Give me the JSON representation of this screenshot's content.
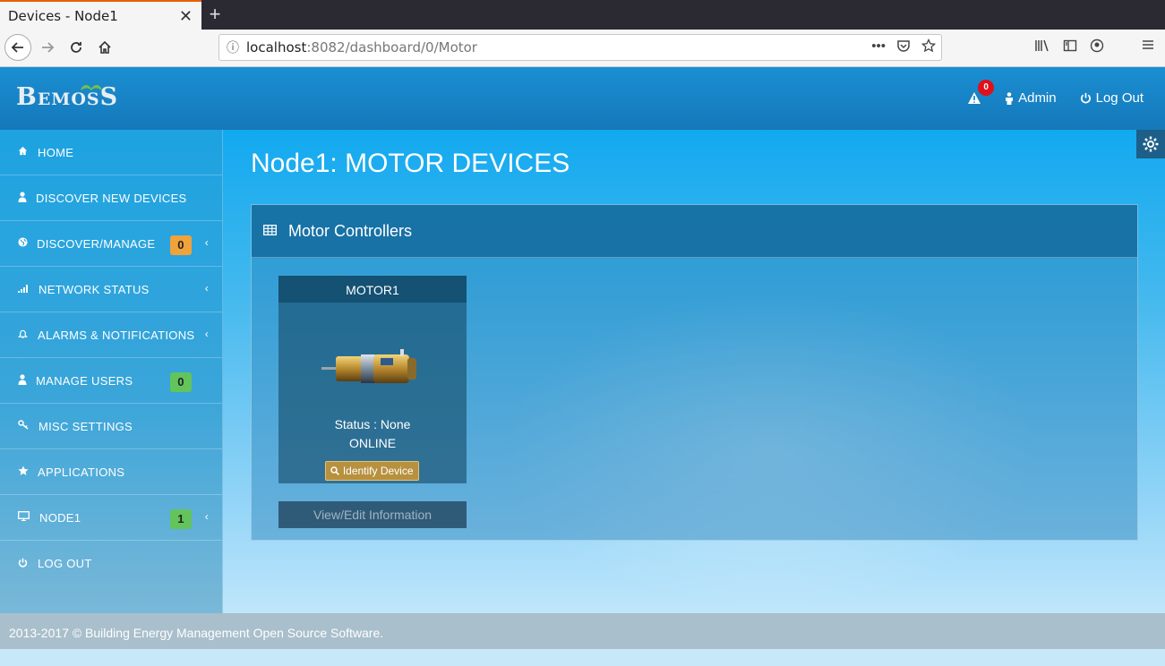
{
  "browser": {
    "tab_title": "Devices - Node1",
    "tab_close": "✕",
    "new_tab": "+",
    "url_host": "localhost",
    "url_rest": ":8082/dashboard/0/Motor",
    "url_more": "•••"
  },
  "header": {
    "logo_text": "BemosS",
    "alert_count": "0",
    "admin_label": "Admin",
    "logout_label": "Log Out"
  },
  "sidebar": {
    "items": [
      {
        "label": "HOME",
        "icon": "home-icon"
      },
      {
        "label": "DISCOVER NEW DEVICES",
        "icon": "user-icon"
      },
      {
        "label": "DISCOVER/MANAGE",
        "icon": "globe-icon",
        "badge": "0"
      },
      {
        "label": "NETWORK STATUS",
        "icon": "signal-icon"
      },
      {
        "label": "ALARMS & NOTIFICATIONS",
        "icon": "bell-icon"
      },
      {
        "label": "MANAGE USERS",
        "icon": "user-icon",
        "badge": "0"
      },
      {
        "label": "MISC SETTINGS",
        "icon": "key-icon"
      },
      {
        "label": "APPLICATIONS",
        "icon": "star-icon"
      },
      {
        "label": "NODE1",
        "icon": "monitor-icon",
        "badge": "1"
      },
      {
        "label": "LOG OUT",
        "icon": "power-icon"
      }
    ]
  },
  "main": {
    "page_title": "Node1: MOTOR DEVICES",
    "panel_title": "Motor Controllers",
    "device": {
      "name": "MOTOR1",
      "status": "Status : None",
      "online": "ONLINE",
      "identify_label": "Identify Device",
      "view_label": "View/Edit Information"
    }
  },
  "footer": {
    "text": "2013-2017 © Building Energy Management Open Source Software."
  },
  "colors": {
    "header_blue": "#1a8fd3",
    "badge_orange": "#f0a23b",
    "badge_green": "#62c45b",
    "alert_red": "#e0101a",
    "identify_gold": "#b8913f"
  }
}
